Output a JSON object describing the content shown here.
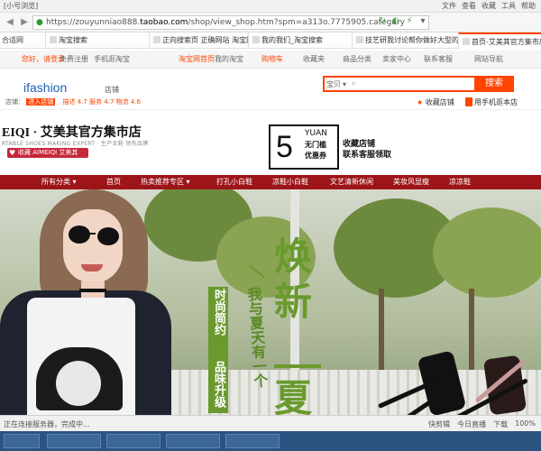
{
  "window": {
    "title": "[小号浏览]",
    "menus": [
      "文件",
      "查看",
      "收藏",
      "工具",
      "帮助"
    ]
  },
  "addressbar": {
    "url_prefix": "https://zouyunniao888.",
    "url_host": "taobao.com",
    "url_path": "/shop/view_shop.htm?spm=a313o.7775905.category",
    "icons": [
      "refresh-icon",
      "compat-icon",
      "lightning-icon",
      "dropdown-icon"
    ]
  },
  "bookmarks": {
    "first": "合适网",
    "tabs": [
      {
        "label": "淘宝搜索",
        "active": false
      },
      {
        "label": "正向搜索页 正确网站 淘宝网",
        "active": false
      },
      {
        "label": "我的我们_淘宝搜索",
        "active": false
      },
      {
        "label": "技艺研我讨论帮你做好大型的",
        "active": false
      },
      {
        "label": "首页-艾美其官方集市店-淘宝网",
        "active": true
      }
    ]
  },
  "taobao_nav": {
    "hello": "您好，请登录",
    "register": "免费注册",
    "mobile": "手机逛淘宝",
    "items": [
      "淘宝网首页",
      "我的淘宝",
      "购物车",
      "收藏夹",
      "商品分类",
      "卖家中心",
      "联系客服",
      "网站导航"
    ]
  },
  "header": {
    "logo": "ifashion",
    "logo_sub": "店铺",
    "shop_label": "店铺：",
    "shop_badge": "进入店铺",
    "ratings": "描述 4.7  服务 4.7  物流 4.6",
    "search_scope": "宝贝",
    "search_button": "搜索",
    "favorite_shop": "收藏店铺",
    "mobile_shop": "用手机逛本店"
  },
  "banner": {
    "shop_name": "EIQI · 艾美其官方集市店",
    "slogan": "RTABLE SHOES MAKING EXPERT · 生产女鞋 领先品牌",
    "favorite_button": "收藏 AIMEIQI 艾美其",
    "coupon_value": "5",
    "coupon_unit": "YUAN",
    "coupon_line1": "无门槛",
    "coupon_line2": "优惠券",
    "coupon_tip1": "收藏店铺",
    "coupon_tip2": "联系客服领取"
  },
  "category_nav": {
    "all": "所有分类 ▾",
    "items": [
      "首页",
      "热卖推荐专区 ▾",
      "打孔小白鞋",
      "凉鞋小白鞋",
      "文艺清新休闲",
      "美妆风显瘦",
      "凉凉鞋"
    ]
  },
  "hero": {
    "v_text1": "时尚简约",
    "v_text2": "品味升级",
    "mid_text": "我与夏天有一个",
    "big1": "焕",
    "big2": "新",
    "big3": "夏"
  },
  "status": {
    "left": "正在连接服务器，完成中...",
    "right": [
      "快剪辑",
      "今日直播",
      "下载",
      "100%"
    ]
  }
}
